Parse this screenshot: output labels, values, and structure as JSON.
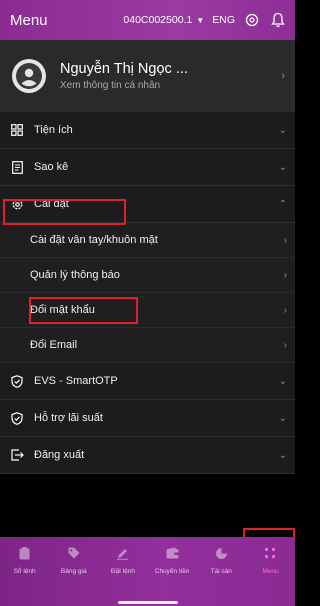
{
  "header": {
    "title": "Menu",
    "account": "040C002500.1",
    "language": "ENG"
  },
  "profile": {
    "name": "Nguyễn Thị Ngọc ...",
    "subtitle": "Xem thông tin cá nhân"
  },
  "menu": {
    "utilities": "Tiện ích",
    "statement": "Sao kê",
    "settings": "Cài đặt",
    "settings_items": [
      "Cài đặt vân tay/khuôn mặt",
      "Quản lý thông báo",
      "Đổi mật khẩu",
      "Đổi Email"
    ],
    "evs": "EVS - SmartOTP",
    "interest": "Hỗ trợ lãi suất",
    "logout": "Đăng xuất"
  },
  "tabs": [
    {
      "label": "Sổ lệnh",
      "icon": "clipboard-icon"
    },
    {
      "label": "Bảng giá",
      "icon": "tag-icon"
    },
    {
      "label": "Đặt lệnh",
      "icon": "pen-icon"
    },
    {
      "label": "Chuyển tiền",
      "icon": "wallet-icon"
    },
    {
      "label": "Tài sản",
      "icon": "pie-icon"
    },
    {
      "label": "Menu",
      "icon": "grid-icon",
      "active": true
    }
  ],
  "colors": {
    "accent": "#8f2e99",
    "highlight": "#e0202a",
    "active_tab": "#ff6ad1",
    "background": "#1c1c1e"
  }
}
